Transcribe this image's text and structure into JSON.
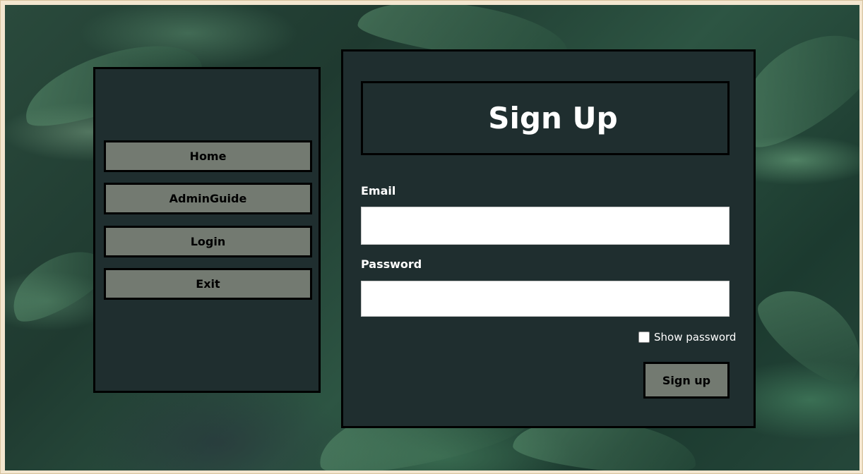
{
  "nav": {
    "items": [
      {
        "label": "Home"
      },
      {
        "label": "AdminGuide"
      },
      {
        "label": "Login"
      },
      {
        "label": "Exit"
      }
    ]
  },
  "form": {
    "title": "Sign Up",
    "email_label": "Email",
    "email_value": "",
    "password_label": "Password",
    "password_value": "",
    "show_password_label": "Show password",
    "show_password_checked": false,
    "submit_label": "Sign up"
  },
  "colors": {
    "panel_bg": "#1f2e2f",
    "button_bg": "#737a71",
    "border": "#000000",
    "text_light": "#ffffff"
  }
}
